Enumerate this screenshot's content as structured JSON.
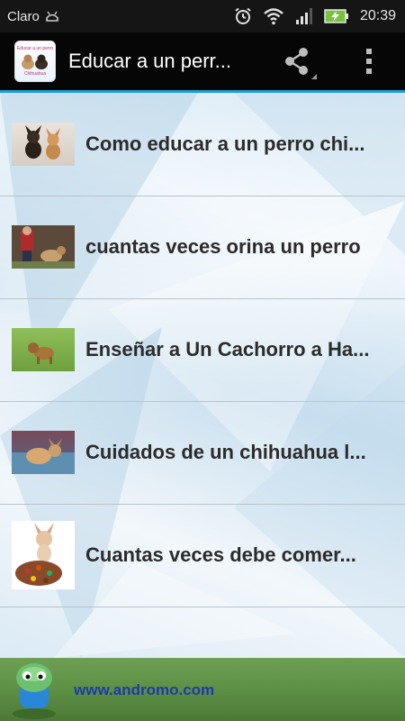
{
  "status_bar": {
    "carrier": "Claro",
    "time": "20:39",
    "icons": [
      "android-debug-icon",
      "alarm-icon",
      "wifi-icon",
      "signal-icon",
      "battery-charging-icon"
    ]
  },
  "action_bar": {
    "title": "Educar a un perr...",
    "app_icon_text_top": "Educar a un perro",
    "app_icon_text_bottom": "Chihuahua",
    "icons": [
      "share-icon",
      "overflow-menu-icon"
    ]
  },
  "list": {
    "items": [
      {
        "label": "Como educar a un perro chi...",
        "thumb": "two-chihuahuas"
      },
      {
        "label": "cuantas veces orina un perro",
        "thumb": "person-with-dog"
      },
      {
        "label": "Enseñar a Un Cachorro a Ha...",
        "thumb": "puppy-on-grass"
      },
      {
        "label": "Cuidados de un chihuahua l...",
        "thumb": "chihuahua-on-blanket"
      },
      {
        "label": "Cuantas veces debe comer...",
        "thumb": "chihuahua-with-food"
      }
    ]
  },
  "banner": {
    "text": "www.andromo.com",
    "icon": "andromo-robot-icon"
  },
  "colors": {
    "accent": "#1aa0d8",
    "banner_green": "#5d8f45",
    "banner_link": "#1e3aa8"
  }
}
